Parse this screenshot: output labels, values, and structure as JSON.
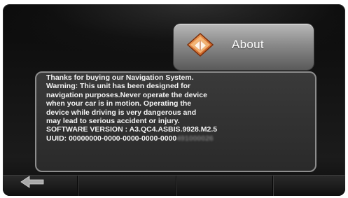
{
  "about": {
    "title": "About",
    "icon": "about-book-icon"
  },
  "info": {
    "lines": [
      "Thanks for buying our Navigation System.",
      "Warning: This unit has been designed for",
      "navigation purposes.Never operate the device",
      "when your car is in motion. Operating the",
      "device  while driving is very dangerous and",
      "may lead to serious accident or injury.",
      "SOFTWARE VERSION : A3.QC4.ASBIS.9928.M2.5"
    ],
    "uuid_label": "UUID: 00000000-0000-0000-0000-0000",
    "uuid_blurred": "491000026"
  },
  "bottom_bar": {
    "back_icon": "back-arrow-icon"
  },
  "colors": {
    "background": "#141414",
    "panel_border": "#8d8d8d",
    "text": "#f4f4f4"
  }
}
